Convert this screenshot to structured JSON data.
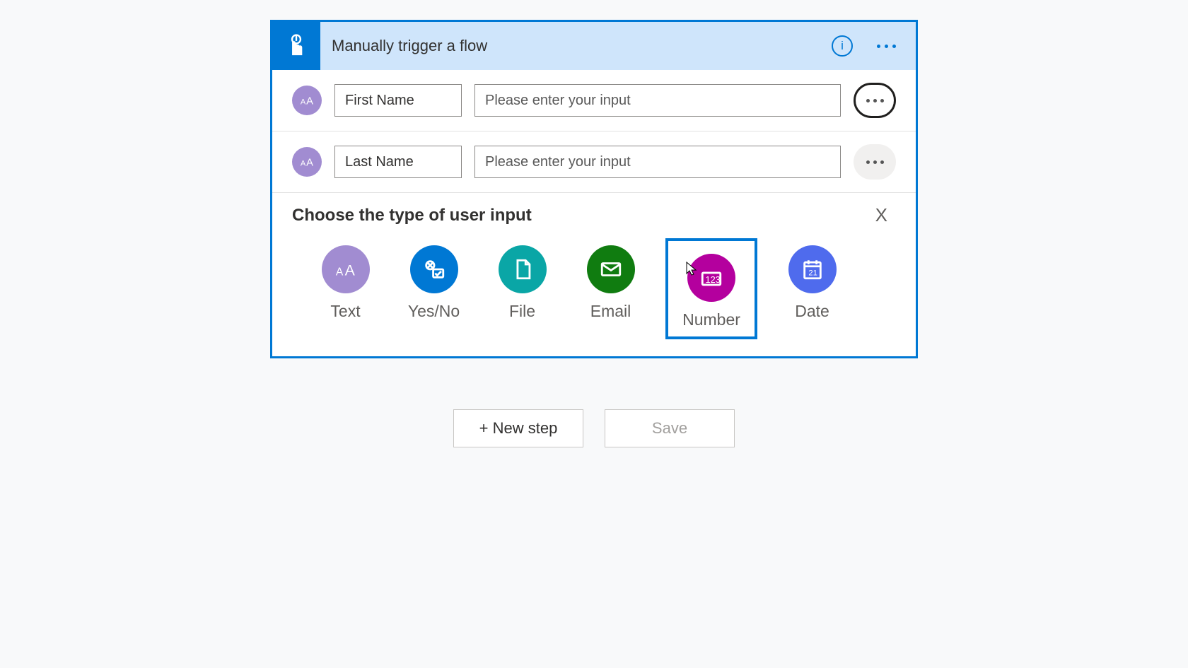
{
  "trigger": {
    "title": "Manually trigger a flow"
  },
  "inputs": [
    {
      "label": "First Name",
      "placeholder": "Please enter your input",
      "more_focused": true
    },
    {
      "label": "Last Name",
      "placeholder": "Please enter your input",
      "more_focused": false
    }
  ],
  "chooser": {
    "title": "Choose the type of user input",
    "close": "X",
    "options": [
      {
        "key": "text",
        "label": "Text"
      },
      {
        "key": "yesno",
        "label": "Yes/No"
      },
      {
        "key": "file",
        "label": "File"
      },
      {
        "key": "email",
        "label": "Email"
      },
      {
        "key": "number",
        "label": "Number",
        "selected": true
      },
      {
        "key": "date",
        "label": "Date"
      }
    ]
  },
  "footer": {
    "new_step": "+ New step",
    "save": "Save"
  }
}
